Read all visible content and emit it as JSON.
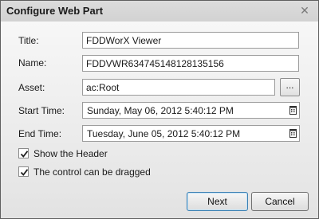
{
  "dialog": {
    "title": "Configure Web Part",
    "close_glyph": "✕"
  },
  "form": {
    "title_label": "Title:",
    "title_value": "FDDWorX Viewer",
    "name_label": "Name:",
    "name_value": "FDDVWR634745148128135156",
    "asset_label": "Asset:",
    "asset_value": "ac:Root",
    "asset_browse_label": "...",
    "start_label": "Start Time:",
    "start_value": "Sunday, May 06, 2012 5:40:12 PM",
    "end_label": "End Time:",
    "end_value": "Tuesday, June 05, 2012 5:40:12 PM"
  },
  "options": {
    "show_header_label": "Show the Header",
    "show_header_checked": true,
    "draggable_label": "The control can be dragged",
    "draggable_checked": true
  },
  "buttons": {
    "next_label": "Next",
    "cancel_label": "Cancel"
  },
  "icons": {
    "close": "close-icon",
    "calendar": "calendar-icon",
    "check": "checkmark-icon"
  },
  "colors": {
    "titlebar": "#d6d6d6",
    "border": "#5f5f5f",
    "default_button_border": "#3c7fb1"
  }
}
